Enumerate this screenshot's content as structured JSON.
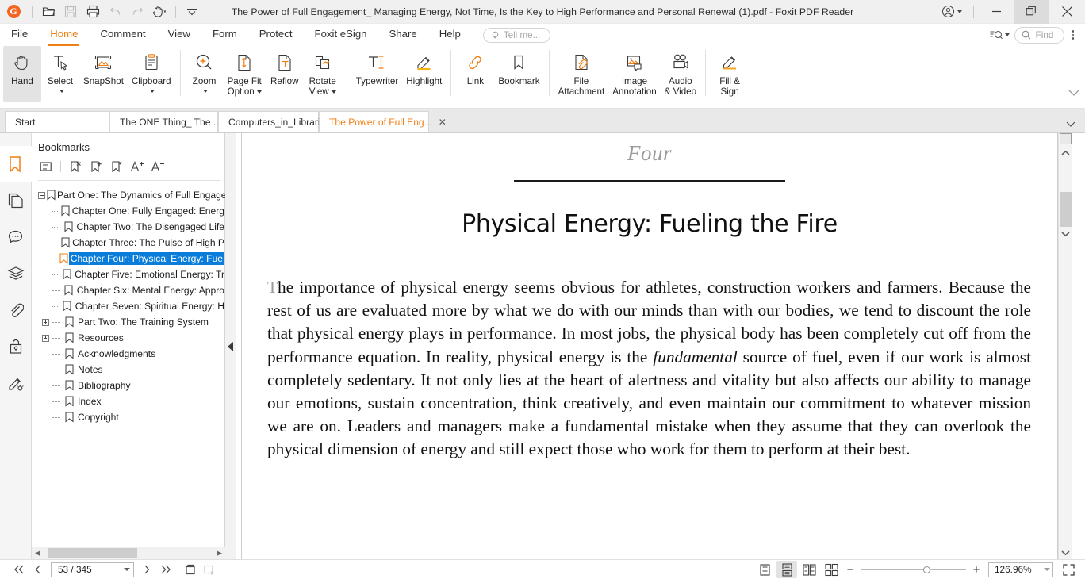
{
  "window": {
    "title": "The Power of Full Engagement_ Managing Energy, Not Time, Is the Key to High Performance and Personal Renewal  (1).pdf - Foxit PDF Reader",
    "logo_letter": "G",
    "quick_access": [
      {
        "name": "open-file-icon",
        "label": "Open"
      },
      {
        "name": "save-icon",
        "label": "Save"
      },
      {
        "name": "print-icon",
        "label": "Print"
      },
      {
        "name": "undo-icon",
        "label": "Undo"
      },
      {
        "name": "redo-icon",
        "label": "Redo"
      },
      {
        "name": "hand-tool-icon",
        "label": "Hand Tool"
      },
      {
        "name": "customize-toolbar-icon",
        "label": "Customize"
      }
    ],
    "controls": {
      "account": "Account",
      "minimize": "Minimize",
      "restore": "Restore",
      "close": "Close"
    }
  },
  "menu": {
    "items": [
      {
        "label": "File",
        "active": false
      },
      {
        "label": "Home",
        "active": true
      },
      {
        "label": "Comment",
        "active": false
      },
      {
        "label": "View",
        "active": false
      },
      {
        "label": "Form",
        "active": false
      },
      {
        "label": "Protect",
        "active": false
      },
      {
        "label": "Foxit eSign",
        "active": false
      },
      {
        "label": "Share",
        "active": false
      },
      {
        "label": "Help",
        "active": false
      }
    ],
    "tell_me_placeholder": "Tell me...",
    "find_placeholder": "Find"
  },
  "ribbon": {
    "groups": [
      {
        "buttons": [
          {
            "label": "Hand",
            "label2": "",
            "icon": "hand-icon",
            "active": true,
            "dropdown": false
          },
          {
            "label": "Select",
            "label2": "",
            "icon": "select-text-icon",
            "active": false,
            "dropdown": true
          },
          {
            "label": "SnapShot",
            "label2": "",
            "icon": "snapshot-icon",
            "active": false,
            "dropdown": false
          },
          {
            "label": "Clipboard",
            "label2": "",
            "icon": "clipboard-icon",
            "active": false,
            "dropdown": true
          }
        ]
      },
      {
        "buttons": [
          {
            "label": "Zoom",
            "label2": "",
            "icon": "zoom-in-icon",
            "active": false,
            "dropdown": true
          },
          {
            "label": "Page Fit",
            "label2": "Option",
            "icon": "page-fit-icon",
            "active": false,
            "dropdown": true,
            "inline_caret": true
          },
          {
            "label": "Reflow",
            "label2": "",
            "icon": "reflow-icon",
            "active": false,
            "dropdown": false
          },
          {
            "label": "Rotate",
            "label2": "View",
            "icon": "rotate-view-icon",
            "active": false,
            "dropdown": true,
            "inline_caret": true
          }
        ]
      },
      {
        "buttons": [
          {
            "label": "Typewriter",
            "label2": "",
            "icon": "typewriter-icon",
            "active": false,
            "dropdown": false
          },
          {
            "label": "Highlight",
            "label2": "",
            "icon": "highlight-icon",
            "active": false,
            "dropdown": false
          }
        ]
      },
      {
        "buttons": [
          {
            "label": "Link",
            "label2": "",
            "icon": "link-icon",
            "active": false,
            "dropdown": false
          },
          {
            "label": "Bookmark",
            "label2": "",
            "icon": "bookmark-icon",
            "active": false,
            "dropdown": false
          }
        ]
      },
      {
        "buttons": [
          {
            "label": "File",
            "label2": "Attachment",
            "icon": "file-attachment-icon",
            "active": false,
            "dropdown": false
          },
          {
            "label": "Image",
            "label2": "Annotation",
            "icon": "image-annotation-icon",
            "active": false,
            "dropdown": false
          },
          {
            "label": "Audio",
            "label2": "& Video",
            "icon": "audio-video-icon",
            "active": false,
            "dropdown": false
          }
        ]
      },
      {
        "buttons": [
          {
            "label": "Fill &",
            "label2": "Sign",
            "icon": "fill-sign-icon",
            "active": false,
            "dropdown": false
          }
        ]
      }
    ]
  },
  "tabs": [
    {
      "label": "Start",
      "active": false,
      "closable": false
    },
    {
      "label": "The ONE Thing_ The ...",
      "active": false,
      "closable": false
    },
    {
      "label": "Computers_in_Librari...",
      "active": false,
      "closable": false
    },
    {
      "label": "The Power of Full Eng...",
      "active": true,
      "closable": true
    }
  ],
  "rail": [
    {
      "name": "bookmarks-panel-icon",
      "label": "Bookmarks",
      "active": true
    },
    {
      "name": "pages-panel-icon",
      "label": "Page Thumbnails",
      "active": false
    },
    {
      "name": "comments-panel-icon",
      "label": "Comments",
      "active": false
    },
    {
      "name": "layers-panel-icon",
      "label": "Layers",
      "active": false
    },
    {
      "name": "attachments-panel-icon",
      "label": "Attachments",
      "active": false
    },
    {
      "name": "security-panel-icon",
      "label": "Security",
      "active": false
    },
    {
      "name": "signatures-panel-icon",
      "label": "Digital Signatures",
      "active": false
    }
  ],
  "bookmarks_panel": {
    "title": "Bookmarks",
    "tools": [
      {
        "name": "bookmark-options-icon",
        "label": "Options"
      },
      {
        "name": "delete-bookmark-icon",
        "label": "Delete Bookmark"
      },
      {
        "name": "new-bookmark-icon",
        "label": "New Bookmark"
      },
      {
        "name": "bookmark-menu-icon",
        "label": "Bookmark Menu"
      },
      {
        "name": "increase-font-icon",
        "label": "Increase Text Size"
      },
      {
        "name": "decrease-font-icon",
        "label": "Decrease Text Size"
      }
    ],
    "items": [
      {
        "label": "Part One: The Dynamics of Full Engage",
        "level": 0,
        "expander": "minus",
        "selected": false
      },
      {
        "label": "Chapter One: Fully Engaged: Energ",
        "level": 1,
        "expander": "none",
        "selected": false
      },
      {
        "label": "Chapter Two: The Disengaged Life",
        "level": 1,
        "expander": "none",
        "selected": false
      },
      {
        "label": "Chapter Three: The Pulse of High P",
        "level": 1,
        "expander": "none",
        "selected": false
      },
      {
        "label": "Chapter Four: Physical Energy: Fue",
        "level": 1,
        "expander": "none",
        "selected": true
      },
      {
        "label": "Chapter Five: Emotional Energy: Tr",
        "level": 1,
        "expander": "none",
        "selected": false
      },
      {
        "label": "Chapter Six: Mental Energy: Appro",
        "level": 1,
        "expander": "none",
        "selected": false
      },
      {
        "label": "Chapter Seven: Spiritual Energy: H",
        "level": 1,
        "expander": "none",
        "selected": false
      },
      {
        "label": "Part Two: The Training System",
        "level": 0,
        "expander": "plus",
        "selected": false
      },
      {
        "label": "Resources",
        "level": 0,
        "expander": "plus",
        "selected": false
      },
      {
        "label": "Acknowledgments",
        "level": 0,
        "expander": "none",
        "selected": false
      },
      {
        "label": "Notes",
        "level": 0,
        "expander": "none",
        "selected": false
      },
      {
        "label": "Bibliography",
        "level": 0,
        "expander": "none",
        "selected": false
      },
      {
        "label": "Index",
        "level": 0,
        "expander": "none",
        "selected": false
      },
      {
        "label": "Copyright",
        "level": 0,
        "expander": "none",
        "selected": false
      }
    ]
  },
  "document": {
    "chapter_number": "Four",
    "chapter_title": "Physical Energy: Fueling the Fire",
    "paragraph_lead": "T",
    "paragraph_part1": "he importance of physical energy seems obvious for athletes, construction workers and farmers. Because the rest of us are evaluated more by what we do with our minds than with our bodies, we tend to discount the role that physical energy plays in performance. In most jobs, the physical body has been completely cut off from the performance equation. In reality, physical energy is the ",
    "paragraph_italic": "fundamental",
    "paragraph_part2": " source of fuel, even if our work is almost completely sedentary. It not only lies at the heart of alertness and vitality but also affects our ability to manage our emotions, sustain concentration, think creatively, and even maintain our commitment to whatever mission we are on. Leaders and managers make a fundamental mistake when they assume that they can overlook the physical dimension of energy and still expect those who work for them to perform at their best."
  },
  "statusbar": {
    "first_page": "First Page",
    "previous_page": "Previous Page",
    "page_value": "53 / 345",
    "next_page": "Next Page",
    "last_page": "Last Page",
    "previous_view": "Previous View",
    "next_view": "Next View",
    "view_modes": [
      {
        "name": "single-page-view-icon",
        "label": "Single Page",
        "active": false
      },
      {
        "name": "continuous-scroll-view-icon",
        "label": "Continuous",
        "active": true
      },
      {
        "name": "two-page-view-icon",
        "label": "Facing",
        "active": false
      },
      {
        "name": "two-page-continuous-view-icon",
        "label": "Continuous Facing",
        "active": false
      }
    ],
    "zoom_out": "−",
    "zoom_in": "+",
    "zoom_value": "126.96%",
    "fullscreen": "Full Screen"
  },
  "colors": {
    "accent": "#f07f13",
    "logo": "#f26522",
    "selection": "#0a7ddb",
    "titlebar_bg": "#f0f0f0",
    "tabbar_bg": "#e9e9e9"
  }
}
